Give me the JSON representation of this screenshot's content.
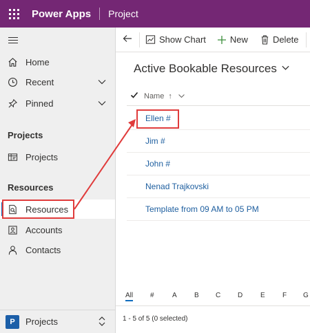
{
  "app": {
    "title": "Power Apps",
    "environment": "Project"
  },
  "sidebar": {
    "home": "Home",
    "recent": "Recent",
    "pinned": "Pinned",
    "section_projects": "Projects",
    "projects": "Projects",
    "section_resources": "Resources",
    "resources": "Resources",
    "accounts": "Accounts",
    "contacts": "Contacts",
    "switcher_badge": "P",
    "switcher_label": "Projects"
  },
  "commands": {
    "show_chart": "Show Chart",
    "new": "New",
    "delete": "Delete"
  },
  "view": {
    "title": "Active Bookable Resources",
    "column_name": "Name",
    "sort_indicator": "↑"
  },
  "rows": [
    "Ellen #",
    "Jim #",
    "John #",
    "Nenad Trajkovski",
    "Template from 09 AM to 05 PM"
  ],
  "alphabet": [
    "All",
    "#",
    "A",
    "B",
    "C",
    "D",
    "E",
    "F",
    "G"
  ],
  "status": "1 - 5 of 5 (0 selected)",
  "colors": {
    "brand": "#742774",
    "link": "#1d5e9f",
    "annotation": "#e03b3b",
    "accent": "#0f6cbd"
  }
}
